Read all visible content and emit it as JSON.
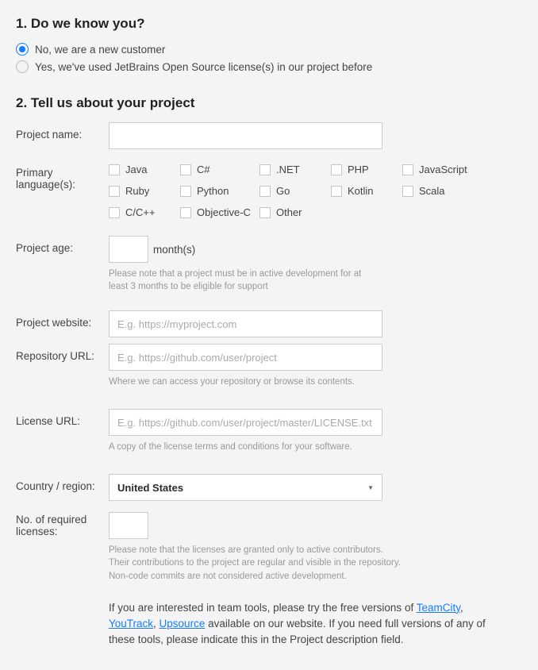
{
  "section1": {
    "heading": "1.  Do we know you?",
    "radios": {
      "new": "No, we are a new customer",
      "existing": "Yes, we've used JetBrains Open Source license(s) in our project before"
    }
  },
  "section2": {
    "heading": "2. Tell us about your project",
    "labels": {
      "project_name": "Project name:",
      "primary_lang": "Primary language(s):",
      "project_age": "Project age:",
      "months_suffix": "month(s)",
      "project_website": "Project website:",
      "repo_url": "Repository URL:",
      "license_url": "License URL:",
      "country": "Country / region:",
      "licenses": "No. of required licenses:"
    },
    "languages": [
      "Java",
      "C#",
      ".NET",
      "PHP",
      "JavaScript",
      "Ruby",
      "Python",
      "Go",
      "Kotlin",
      "Scala",
      "C/C++",
      "Objective-C",
      "Other"
    ],
    "placeholders": {
      "website": "E.g. https://myproject.com",
      "repo": "E.g. https://github.com/user/project",
      "license": "E.g. https://github.com/user/project/master/LICENSE.txt"
    },
    "notes": {
      "age": "Please note that a project must be in active development for at least 3 months to be eligible for support",
      "repo": "Where we can access your repository or browse its contents.",
      "license": "A copy of the license terms and conditions for your software.",
      "licenses1": "Please note that the licenses are granted only to active contributors.",
      "licenses2": "Their contributions to the project are regular and visible in the repository.",
      "licenses3": "Non-code commits are not considered active development."
    },
    "country_value": "United States",
    "tools": {
      "prefix": "If you are interested in team tools, please try the free versions of ",
      "teamcity": "TeamCity",
      "youtrack": "YouTrack",
      "upsource": "Upsource",
      "suffix": " available on our website. If you need full versions of any of these tools, please indicate this in the Project description field."
    }
  }
}
